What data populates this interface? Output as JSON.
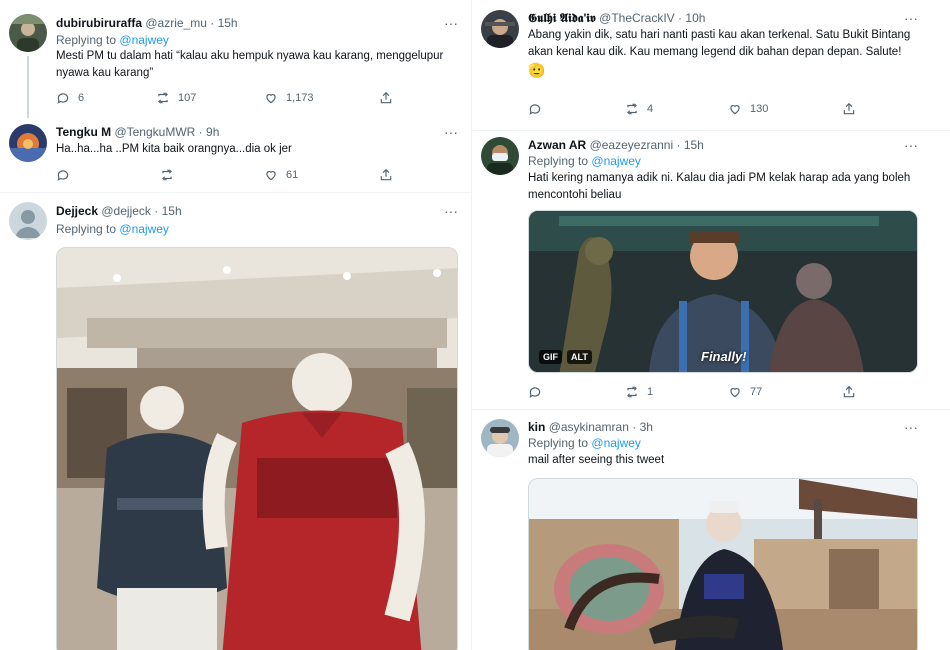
{
  "left": {
    "tweets": [
      {
        "name": "dubirubiruraffa",
        "handle": "@azrie_mu",
        "time": "15h",
        "reply_prefix": "Replying to",
        "reply_to": "@najwey",
        "text": "Mesti PM tu dalam hati “kalau aku hempuk nyawa kau karang, menggelupur nyawa kau karang”",
        "replies": "6",
        "retweets": "107",
        "likes": "1,173"
      },
      {
        "name": "Tengku M",
        "handle": "@TengkuMWR",
        "time": "9h",
        "text": "Ha..ha...ha ..PM kita baik orangnya...dia ok jer",
        "replies": "",
        "retweets": "",
        "likes": "61"
      },
      {
        "name": "Dejjeck",
        "handle": "@dejjeck",
        "time": "15h",
        "reply_prefix": "Replying to",
        "reply_to": "@najwey"
      }
    ]
  },
  "right": {
    "tweets": [
      {
        "name": "𝕲𝖚𝖑𝖍𝖎 𝕬𝖎𝖉𝖆'𝖎𝖛",
        "handle": "@TheCrackIV",
        "time": "10h",
        "text": "Abang yakin dik, satu hari nanti pasti kau akan terkenal. Satu Bukit Bintang akan kenal kau dik. Kau memang legend dik bahan depan depan. Salute!",
        "emoji": "🫡",
        "replies": "",
        "retweets": "4",
        "likes": "130"
      },
      {
        "name": "Azwan AR",
        "handle": "@eazeyezranni",
        "time": "15h",
        "reply_prefix": "Replying to",
        "reply_to": "@najwey",
        "text": "Hati kering namanya adik ni. Kalau dia jadi PM kelak harap ada yang boleh mencontohi beliau",
        "gif_label": "GIF",
        "alt_label": "ALT",
        "gif_caption": "Finally!",
        "replies": "",
        "retweets": "1",
        "likes": "77"
      },
      {
        "name": "kin",
        "handle": "@asykinamran",
        "time": "3h",
        "reply_prefix": "Replying to",
        "reply_to": "@najwey",
        "text": "mail after seeing this tweet"
      }
    ]
  },
  "icons": {
    "more": "more-icon",
    "reply": "reply-icon",
    "retweet": "retweet-icon",
    "like": "like-icon",
    "share": "share-icon"
  },
  "colors": {
    "link": "#1d9bf0",
    "muted": "#536471",
    "divider": "#eff3f4"
  }
}
